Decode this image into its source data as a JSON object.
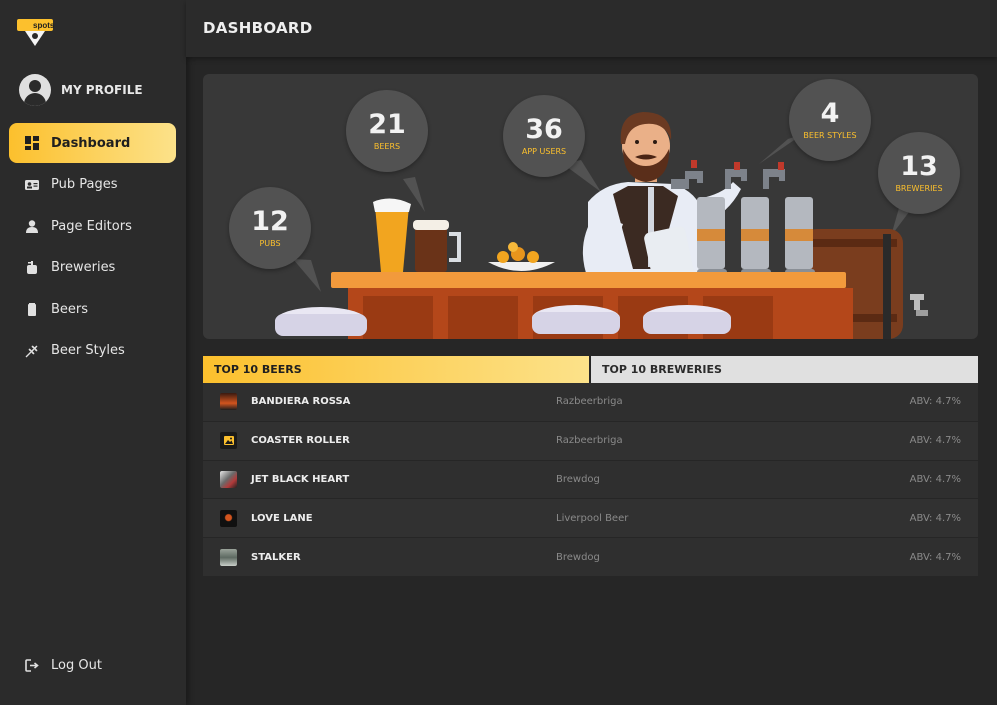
{
  "sidebar": {
    "logo_text": "spots",
    "profile_label": "MY PROFILE",
    "items": [
      {
        "label": "Dashboard",
        "icon": "dashboard-icon",
        "active": true
      },
      {
        "label": "Pub Pages",
        "icon": "id-card-icon"
      },
      {
        "label": "Page Editors",
        "icon": "user-icon"
      },
      {
        "label": "Breweries",
        "icon": "brewery-icon"
      },
      {
        "label": "Beers",
        "icon": "beer-can-icon"
      },
      {
        "label": "Beer Styles",
        "icon": "wheat-icon"
      }
    ],
    "logout_label": "Log Out"
  },
  "header": {
    "title": "DASHBOARD"
  },
  "stats": [
    {
      "value": "12",
      "label": "PUBS"
    },
    {
      "value": "21",
      "label": "BEERS"
    },
    {
      "value": "36",
      "label": "APP USERS"
    },
    {
      "value": "4",
      "label": "BEER STYLES"
    },
    {
      "value": "13",
      "label": "BREWERIES"
    }
  ],
  "tabs": [
    {
      "label": "TOP 10 BEERS",
      "active": true
    },
    {
      "label": "TOP 10 BREWERIES",
      "active": false
    }
  ],
  "beers": [
    {
      "name": "BANDIERA ROSSA",
      "brewery": "Razbeerbriga",
      "abv": "ABV: 4.7%"
    },
    {
      "name": "COASTER ROLLER",
      "brewery": "Razbeerbriga",
      "abv": "ABV: 4.7%"
    },
    {
      "name": "JET BLACK HEART",
      "brewery": "Brewdog",
      "abv": "ABV: 4.7%"
    },
    {
      "name": "LOVE LANE",
      "brewery": "Liverpool Beer",
      "abv": "ABV: 4.7%"
    },
    {
      "name": "STALKER",
      "brewery": "Brewdog",
      "abv": "ABV: 4.7%"
    }
  ],
  "colors": {
    "accent": "#fcc02d",
    "accent_light": "#fce28a",
    "background": "#262626",
    "panel": "#2b2b2b"
  }
}
